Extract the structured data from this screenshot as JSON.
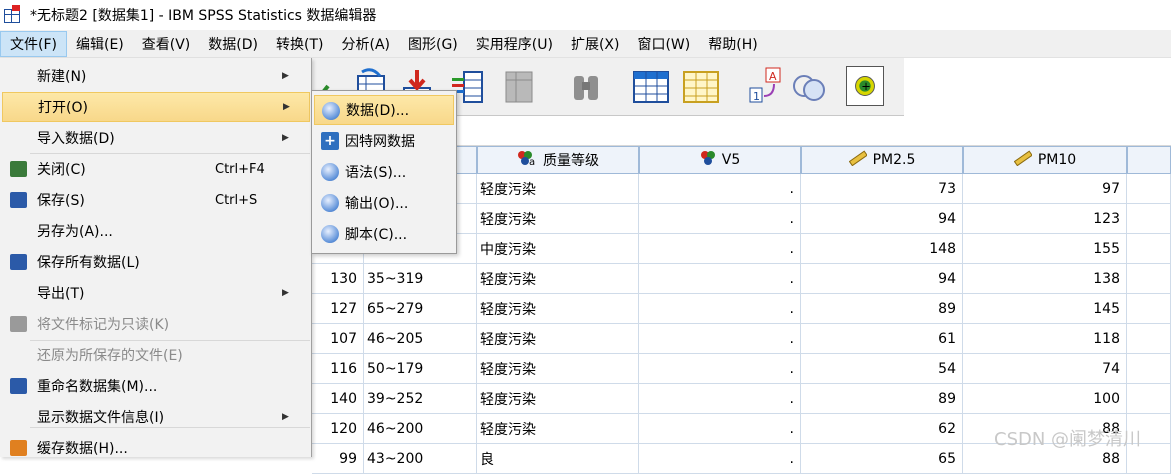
{
  "window": {
    "title": "*无标题2 [数据集1] - IBM SPSS Statistics 数据编辑器"
  },
  "menubar": [
    {
      "label": "文件(F)"
    },
    {
      "label": "编辑(E)"
    },
    {
      "label": "查看(V)"
    },
    {
      "label": "数据(D)"
    },
    {
      "label": "转换(T)"
    },
    {
      "label": "分析(A)"
    },
    {
      "label": "图形(G)"
    },
    {
      "label": "实用程序(U)"
    },
    {
      "label": "扩展(X)"
    },
    {
      "label": "窗口(W)"
    },
    {
      "label": "帮助(H)"
    }
  ],
  "file_menu": [
    {
      "label": "新建(N)",
      "accel": "",
      "submenu": true,
      "icon": "",
      "disabled": false
    },
    {
      "label": "打开(O)",
      "accel": "",
      "submenu": true,
      "icon": "",
      "disabled": false,
      "highlighted": true
    },
    {
      "label": "导入数据(D)",
      "accel": "",
      "submenu": true,
      "icon": "",
      "disabled": false
    },
    {
      "label": "关闭(C)",
      "accel": "Ctrl+F4",
      "submenu": false,
      "icon": "close-icon",
      "disabled": false
    },
    {
      "label": "保存(S)",
      "accel": "Ctrl+S",
      "submenu": false,
      "icon": "save-icon",
      "disabled": false
    },
    {
      "label": "另存为(A)...",
      "accel": "",
      "submenu": false,
      "icon": "",
      "disabled": false
    },
    {
      "label": "保存所有数据(L)",
      "accel": "",
      "submenu": false,
      "icon": "save-all-icon",
      "disabled": false
    },
    {
      "label": "导出(T)",
      "accel": "",
      "submenu": true,
      "icon": "",
      "disabled": false
    },
    {
      "label": "将文件标记为只读(K)",
      "accel": "",
      "submenu": false,
      "icon": "read-only-icon",
      "disabled": true
    },
    {
      "label": "还原为所保存的文件(E)",
      "accel": "",
      "submenu": false,
      "icon": "",
      "disabled": true
    },
    {
      "label": "重命名数据集(M)...",
      "accel": "",
      "submenu": false,
      "icon": "rename-icon",
      "disabled": false
    },
    {
      "label": "显示数据文件信息(I)",
      "accel": "",
      "submenu": true,
      "icon": "",
      "disabled": false
    },
    {
      "label": "缓存数据(H)...",
      "accel": "",
      "submenu": false,
      "icon": "cache-icon",
      "disabled": false
    }
  ],
  "open_submenu": [
    {
      "label": "数据(D)...",
      "icon": "data-file-icon",
      "highlighted": true
    },
    {
      "label": "因特网数据",
      "icon": "internet-data-icon"
    },
    {
      "label": "语法(S)...",
      "icon": "syntax-file-icon"
    },
    {
      "label": "输出(O)...",
      "icon": "output-file-icon"
    },
    {
      "label": "脚本(C)...",
      "icon": "script-file-icon"
    }
  ],
  "grid": {
    "headers": [
      {
        "label": "质量等级",
        "icon": "nominal-string-icon"
      },
      {
        "label": "V5",
        "icon": "nominal-icon"
      },
      {
        "label": "PM2.5",
        "icon": "scale-ruler-icon"
      },
      {
        "label": "PM10",
        "icon": "scale-ruler-icon"
      }
    ],
    "rows": [
      {
        "a": "",
        "b": "",
        "c": "轻度污染",
        "d": ".",
        "e": "73",
        "f": "97"
      },
      {
        "a": "",
        "b": "",
        "c": "轻度污染",
        "d": ".",
        "e": "94",
        "f": "123"
      },
      {
        "a": "",
        "b": "",
        "c": "中度污染",
        "d": ".",
        "e": "148",
        "f": "155"
      },
      {
        "a": "130",
        "b": "35~319",
        "c": "轻度污染",
        "d": ".",
        "e": "94",
        "f": "138"
      },
      {
        "a": "127",
        "b": "65~279",
        "c": "轻度污染",
        "d": ".",
        "e": "89",
        "f": "145"
      },
      {
        "a": "107",
        "b": "46~205",
        "c": "轻度污染",
        "d": ".",
        "e": "61",
        "f": "118"
      },
      {
        "a": "116",
        "b": "50~179",
        "c": "轻度污染",
        "d": ".",
        "e": "54",
        "f": "74"
      },
      {
        "a": "140",
        "b": "39~252",
        "c": "轻度污染",
        "d": ".",
        "e": "89",
        "f": "100"
      },
      {
        "a": "120",
        "b": "46~200",
        "c": "轻度污染",
        "d": ".",
        "e": "62",
        "f": "88"
      },
      {
        "a": "99",
        "b": "43~200",
        "c": "良",
        "d": ".",
        "e": "65",
        "f": "88"
      }
    ]
  },
  "toolbar_icons": [
    "recall-dialog-icon",
    "undo-icon",
    "goto-case-icon",
    "goto-variable-icon",
    "variables-icon",
    "find-icon",
    "insert-cases-icon",
    "insert-variable-icon",
    "split-file-icon",
    "weight-cases-icon",
    "select-cases-icon",
    "value-labels-icon",
    "use-sets-icon",
    "spell-check-icon"
  ],
  "watermark": "CSDN @阑梦清川"
}
